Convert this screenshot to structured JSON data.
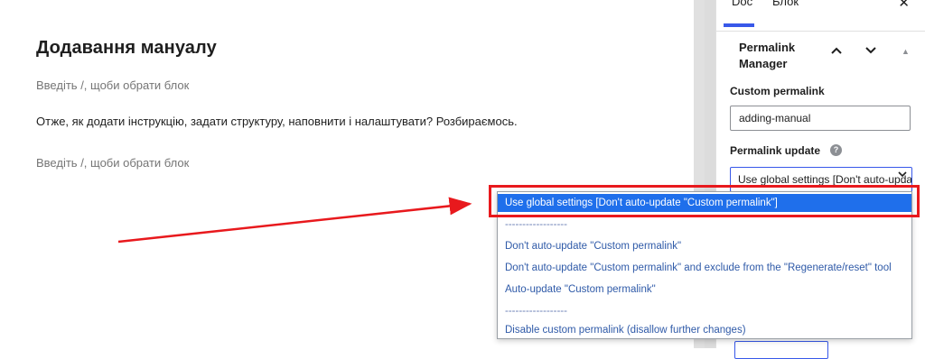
{
  "editor": {
    "post_title": "Додавання мануалу",
    "placeholder_1": "Введіть /, щоби обрати блок",
    "paragraph": "Отже, як додати інструкцію, задати структуру, наповнити і налаштувати? Розбираємось.",
    "placeholder_2": "Введіть /, щоби обрати блок"
  },
  "sidebar": {
    "tab_doc": "Doc",
    "tab_block": "Блок",
    "close_glyph": "✕",
    "panel": {
      "title": "Permalink Manager",
      "up_glyph": "⌃",
      "down_glyph": "⌄",
      "toggle_glyph": "▲"
    },
    "custom_permalink": {
      "label": "Custom permalink",
      "value": "adding-manual"
    },
    "permalink_update": {
      "label": "Permalink update",
      "help_glyph": "?",
      "selected": "Use global settings [Don't auto-update \"Custom permalink\"]",
      "chevron_glyph": "▼"
    }
  },
  "dropdown": {
    "options": [
      "Use global settings [Don't auto-update \"Custom permalink\"]",
      "------------------",
      "Don't auto-update \"Custom permalink\"",
      "Don't auto-update \"Custom permalink\" and exclude from the \"Regenerate/reset\" tool",
      "Auto-update \"Custom permalink\"",
      "------------------",
      "Disable custom permalink (disallow further changes)"
    ],
    "selected_index": 0
  },
  "colors": {
    "accent": "#3858e9",
    "selected_option_bg": "#1f6feb",
    "annotation_red": "#e8191d",
    "option_text": "#2f5aa8"
  }
}
